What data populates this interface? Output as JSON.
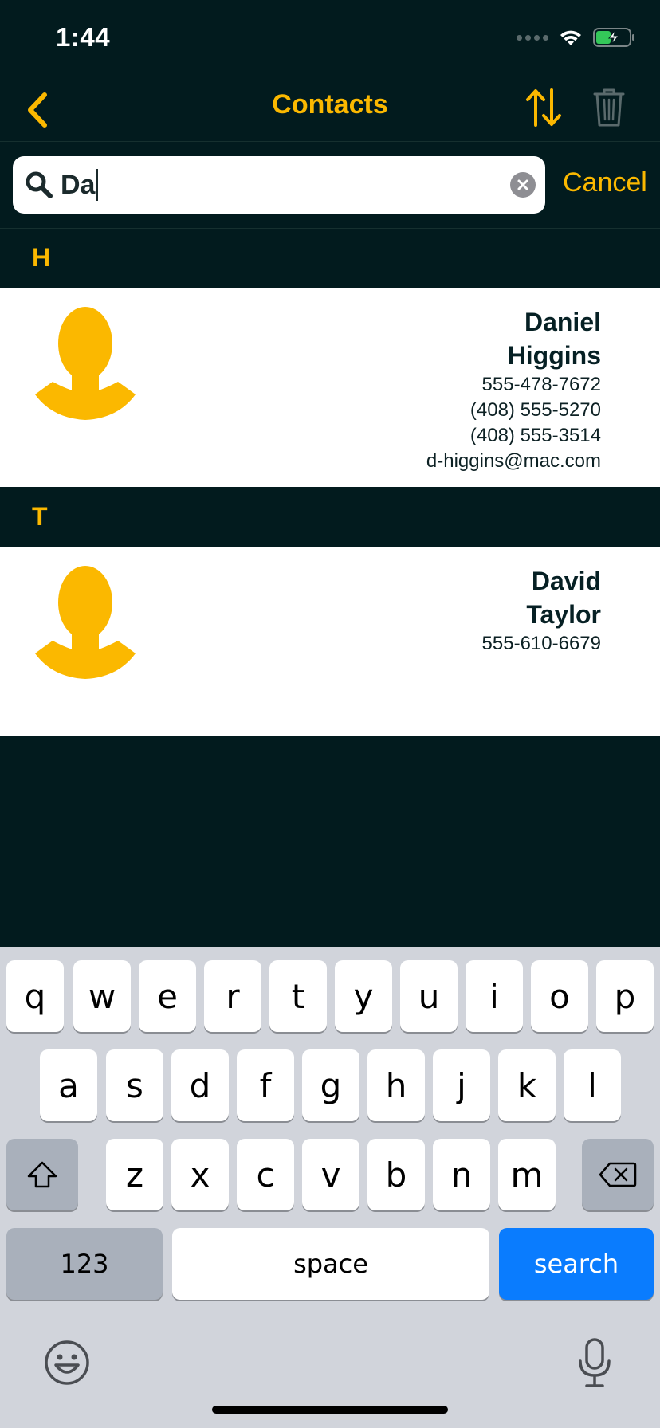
{
  "status_bar": {
    "time": "1:44"
  },
  "nav": {
    "title": "Contacts"
  },
  "search": {
    "value": "Da",
    "cancel_label": "Cancel"
  },
  "sections": [
    {
      "letter": "H",
      "contact": {
        "first_name": "Daniel",
        "last_name": "Higgins",
        "lines": [
          "555-478-7672",
          "(408) 555-5270",
          "(408) 555-3514",
          "d-higgins@mac.com"
        ]
      }
    },
    {
      "letter": "T",
      "contact": {
        "first_name": "David",
        "last_name": "Taylor",
        "lines": [
          "555-610-6679"
        ]
      }
    }
  ],
  "keyboard": {
    "row1": [
      "q",
      "w",
      "e",
      "r",
      "t",
      "y",
      "u",
      "i",
      "o",
      "p"
    ],
    "row2": [
      "a",
      "s",
      "d",
      "f",
      "g",
      "h",
      "j",
      "k",
      "l"
    ],
    "row3": [
      "z",
      "x",
      "c",
      "v",
      "b",
      "n",
      "m"
    ],
    "numbers_label": "123",
    "space_label": "space",
    "search_label": "search"
  },
  "colors": {
    "background": "#021b1e",
    "accent": "#fbb800",
    "card": "#ffffff",
    "keyboard_bg": "#d1d4db",
    "search_key": "#0a7cfe"
  },
  "icons": [
    "back-chevron-icon",
    "sort-icon",
    "trash-icon",
    "search-icon",
    "clear-icon",
    "wifi-icon",
    "battery-icon",
    "shift-icon",
    "backspace-icon",
    "emoji-icon",
    "microphone-icon"
  ]
}
